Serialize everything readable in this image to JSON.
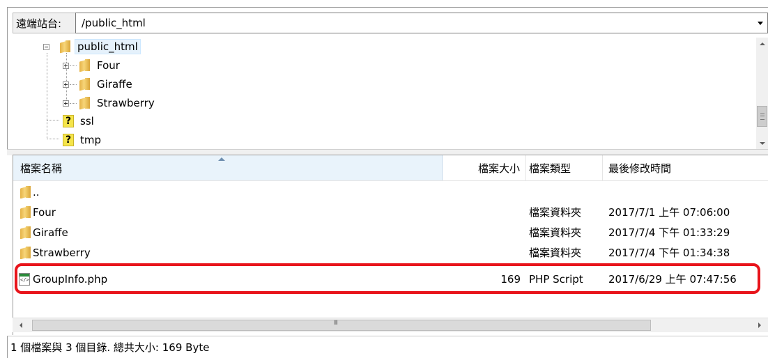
{
  "remote_site": {
    "label": "遠端站台:",
    "path": "/public_html"
  },
  "tree": {
    "items": [
      {
        "label": "public_html",
        "icon": "folder-icon",
        "expander": "minus",
        "selected": true
      },
      {
        "label": "Four",
        "icon": "folder-icon",
        "expander": "plus"
      },
      {
        "label": "Giraffe",
        "icon": "folder-icon",
        "expander": "plus"
      },
      {
        "label": "Strawberry",
        "icon": "folder-icon",
        "expander": "plus"
      },
      {
        "label": "ssl",
        "icon": "question-icon"
      },
      {
        "label": "tmp",
        "icon": "question-icon"
      }
    ]
  },
  "file_list": {
    "columns": {
      "name": "檔案名稱",
      "size": "檔案大小",
      "type": "檔案類型",
      "modified": "最後修改時間"
    },
    "rows": [
      {
        "name": "..",
        "size": "",
        "type": "",
        "modified": "",
        "icon": "folder-icon"
      },
      {
        "name": "Four",
        "size": "",
        "type": "檔案資料夾",
        "modified": "2017/7/1 上午 07:06:00",
        "icon": "folder-icon"
      },
      {
        "name": "Giraffe",
        "size": "",
        "type": "檔案資料夾",
        "modified": "2017/7/4 下午 01:33:29",
        "icon": "folder-icon"
      },
      {
        "name": "Strawberry",
        "size": "",
        "type": "檔案資料夾",
        "modified": "2017/7/4 下午 01:34:38",
        "icon": "folder-icon"
      },
      {
        "name": "GroupInfo.php",
        "size": "169",
        "type": "PHP Script",
        "modified": "2017/6/29 上午 07:47:56",
        "icon": "php-file-icon"
      }
    ]
  },
  "status": {
    "text": "1 個檔案與 3 個目錄. 總共大小: 169 Byte"
  },
  "colors": {
    "highlight": "#e8141b",
    "selection": "#e5f1fb"
  }
}
